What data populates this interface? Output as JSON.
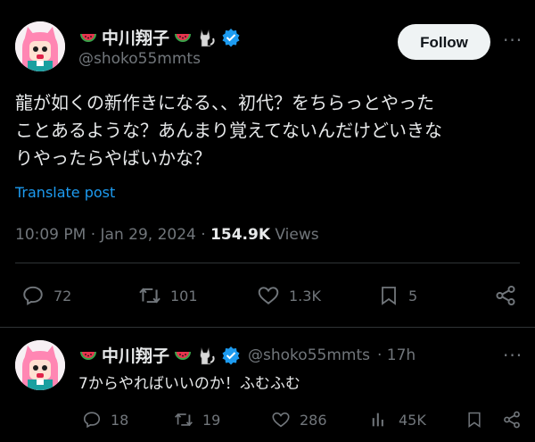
{
  "tweet": {
    "author_name": "中川翔子",
    "author_handle": "@shoko55mmts",
    "follow_label": "Follow",
    "more_label": "···",
    "text_lines": [
      "龍が如くの新作きになる、、初代？をちらっとやった",
      "ことあるような？あんまり覚えてないんだけどいきな",
      "りやったらやばいかな？"
    ],
    "translate_label": "Translate post",
    "time": "10:09 PM · Jan 29, 2024 · ",
    "views_count": "154.9K",
    "views_label": " Views",
    "actions": {
      "replies": "72",
      "reposts": "101",
      "likes": "1.3K",
      "bookmarks": "5"
    }
  },
  "reply": {
    "author_name": "中川翔子",
    "author_handle": "@shoko55mmts",
    "time": "· 17h",
    "more_label": "···",
    "text": "7からやればいいのか！ふむふむ",
    "actions": {
      "replies": "18",
      "reposts": "19",
      "likes": "286",
      "views": "45K"
    }
  },
  "colors": {
    "accent": "#1d9bf0",
    "muted": "#71767b",
    "verified": "#1d9bf0"
  },
  "icons": [
    "watermelon-icon",
    "black-cat-icon",
    "verified-badge-icon",
    "reply-icon",
    "repost-icon",
    "like-icon",
    "bookmark-icon",
    "share-icon",
    "views-icon"
  ]
}
